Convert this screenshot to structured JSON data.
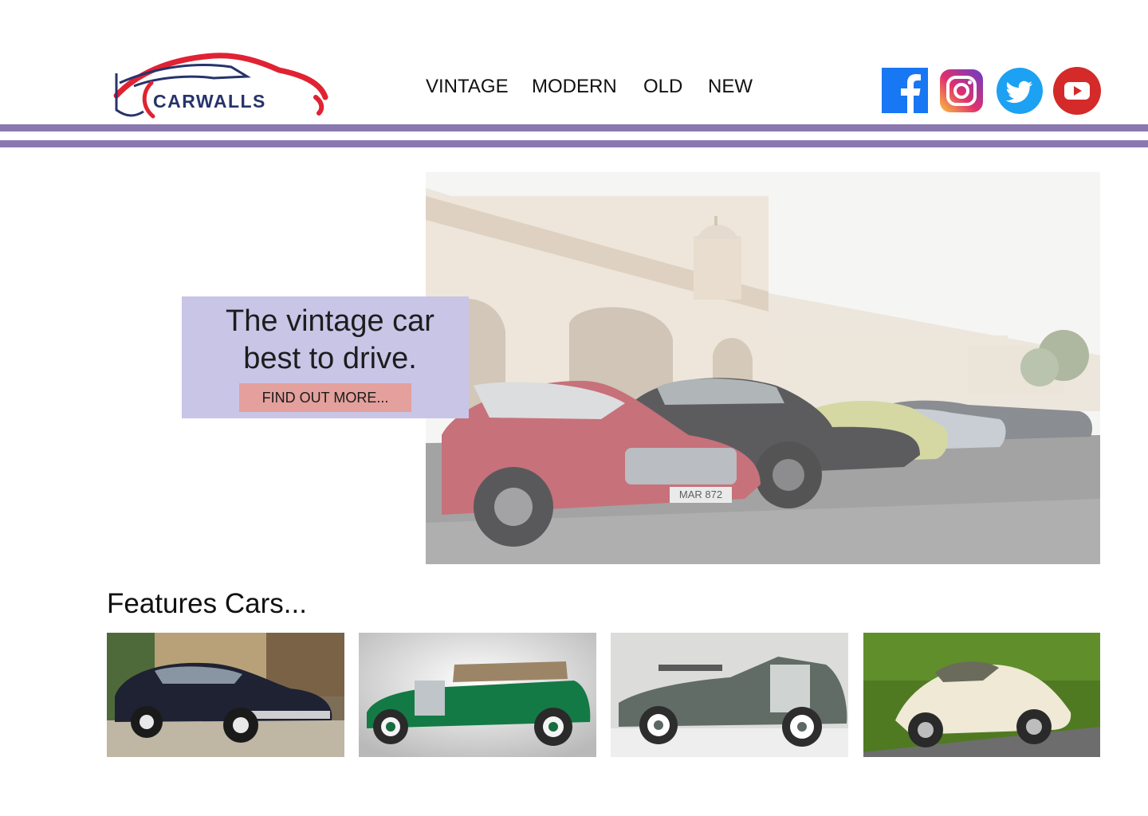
{
  "brand": {
    "name": "CARWALLS",
    "primary_color": "#e02232",
    "text_color": "#27336b"
  },
  "nav": [
    {
      "label": "VINTAGE"
    },
    {
      "label": "MODERN"
    },
    {
      "label": "OLD"
    },
    {
      "label": "NEW"
    }
  ],
  "social": [
    {
      "name": "facebook-icon",
      "color": "#1877f2"
    },
    {
      "name": "instagram-icon",
      "color": "#c13584"
    },
    {
      "name": "twitter-icon",
      "color": "#1da1f2"
    },
    {
      "name": "youtube-icon",
      "color": "#d42a2a"
    }
  ],
  "hero": {
    "title_line1": "The vintage car",
    "title_line2": "best to drive.",
    "cta_label": "FIND OUT MORE...",
    "image": "vintage cars parked in front of a palace",
    "plate_text": "MAR 872"
  },
  "features": {
    "title": "Features Cars...",
    "cars": [
      {
        "name": "black-sedan-image"
      },
      {
        "name": "green-touring-car-image"
      },
      {
        "name": "grey-roadster-image"
      },
      {
        "name": "white-beetle-cabriolet-image"
      }
    ]
  },
  "colors": {
    "divider": "#8a78b0",
    "card_bg": "#c9c5e7",
    "cta_bg": "#e3a09c"
  }
}
